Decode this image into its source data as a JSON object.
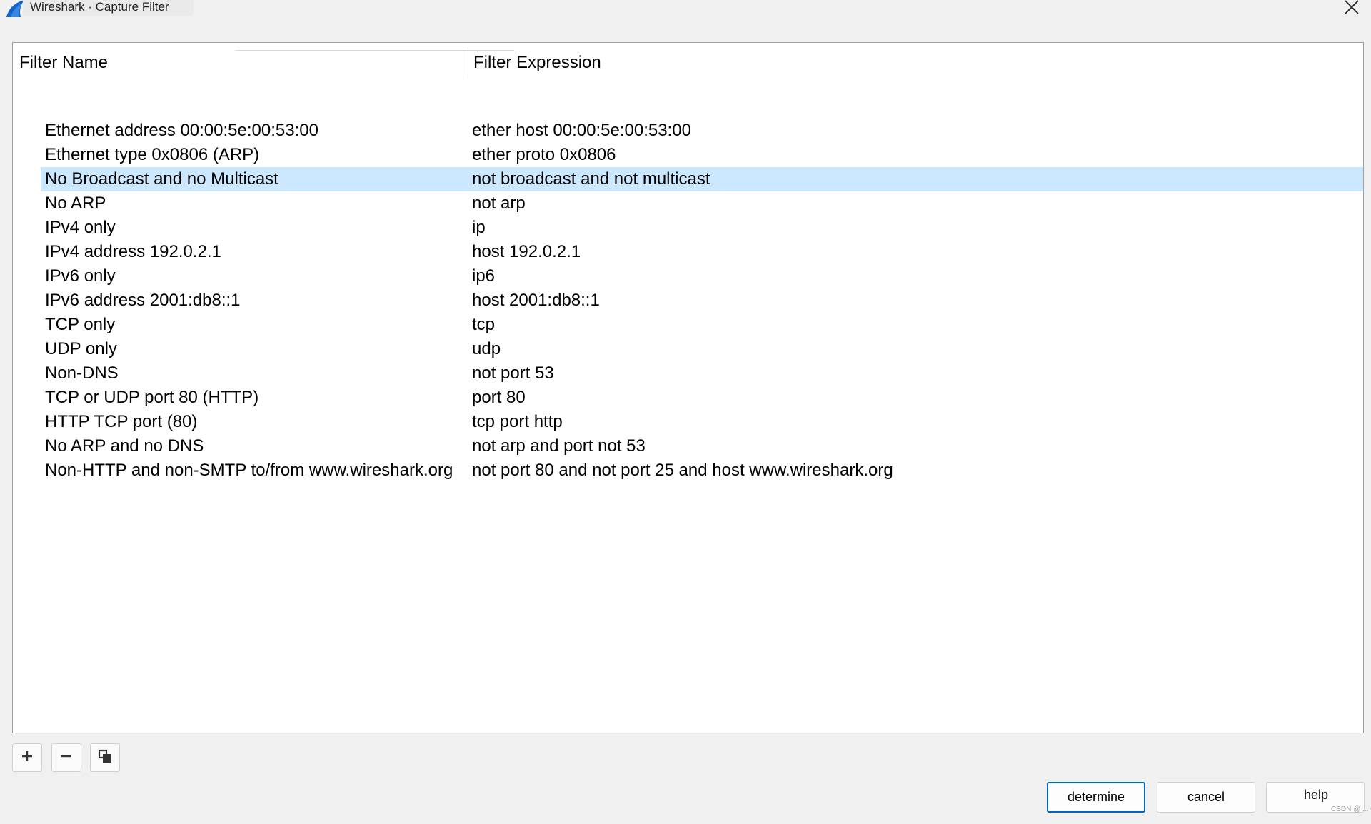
{
  "window": {
    "title": "Wireshark · Capture Filter",
    "icon": "wireshark-fin-icon",
    "accent": "#1764c8"
  },
  "table": {
    "columns": [
      "Filter Name",
      "Filter Expression"
    ],
    "selected_index": 2,
    "selection_color": "#cce8ff",
    "rows": [
      {
        "name": "Ethernet address 00:00:5e:00:53:00",
        "expression": "ether host 00:00:5e:00:53:00"
      },
      {
        "name": "Ethernet type 0x0806 (ARP)",
        "expression": "ether proto 0x0806"
      },
      {
        "name": "No Broadcast and no Multicast",
        "expression": "not broadcast and not multicast"
      },
      {
        "name": "No ARP",
        "expression": "not arp"
      },
      {
        "name": "IPv4 only",
        "expression": "ip"
      },
      {
        "name": "IPv4 address 192.0.2.1",
        "expression": "host 192.0.2.1"
      },
      {
        "name": "IPv6 only",
        "expression": "ip6"
      },
      {
        "name": "IPv6 address 2001:db8::1",
        "expression": "host 2001:db8::1"
      },
      {
        "name": "TCP only",
        "expression": "tcp"
      },
      {
        "name": "UDP only",
        "expression": "udp"
      },
      {
        "name": "Non-DNS",
        "expression": "not port 53"
      },
      {
        "name": "TCP or UDP port 80 (HTTP)",
        "expression": "port 80"
      },
      {
        "name": "HTTP TCP port (80)",
        "expression": "tcp port http"
      },
      {
        "name": "No ARP and no DNS",
        "expression": "not arp and port not 53"
      },
      {
        "name": "Non-HTTP and non-SMTP to/from www.wireshark.org",
        "expression": "not port 80 and not port 25 and host www.wireshark.org"
      }
    ]
  },
  "toolbar": {
    "add_icon": "plus-icon",
    "remove_icon": "minus-icon",
    "copy_icon": "copy-icon"
  },
  "buttons": {
    "ok": "determine",
    "cancel": "cancel",
    "help": "help"
  },
  "watermark": "CSDN @ ... Old 518"
}
